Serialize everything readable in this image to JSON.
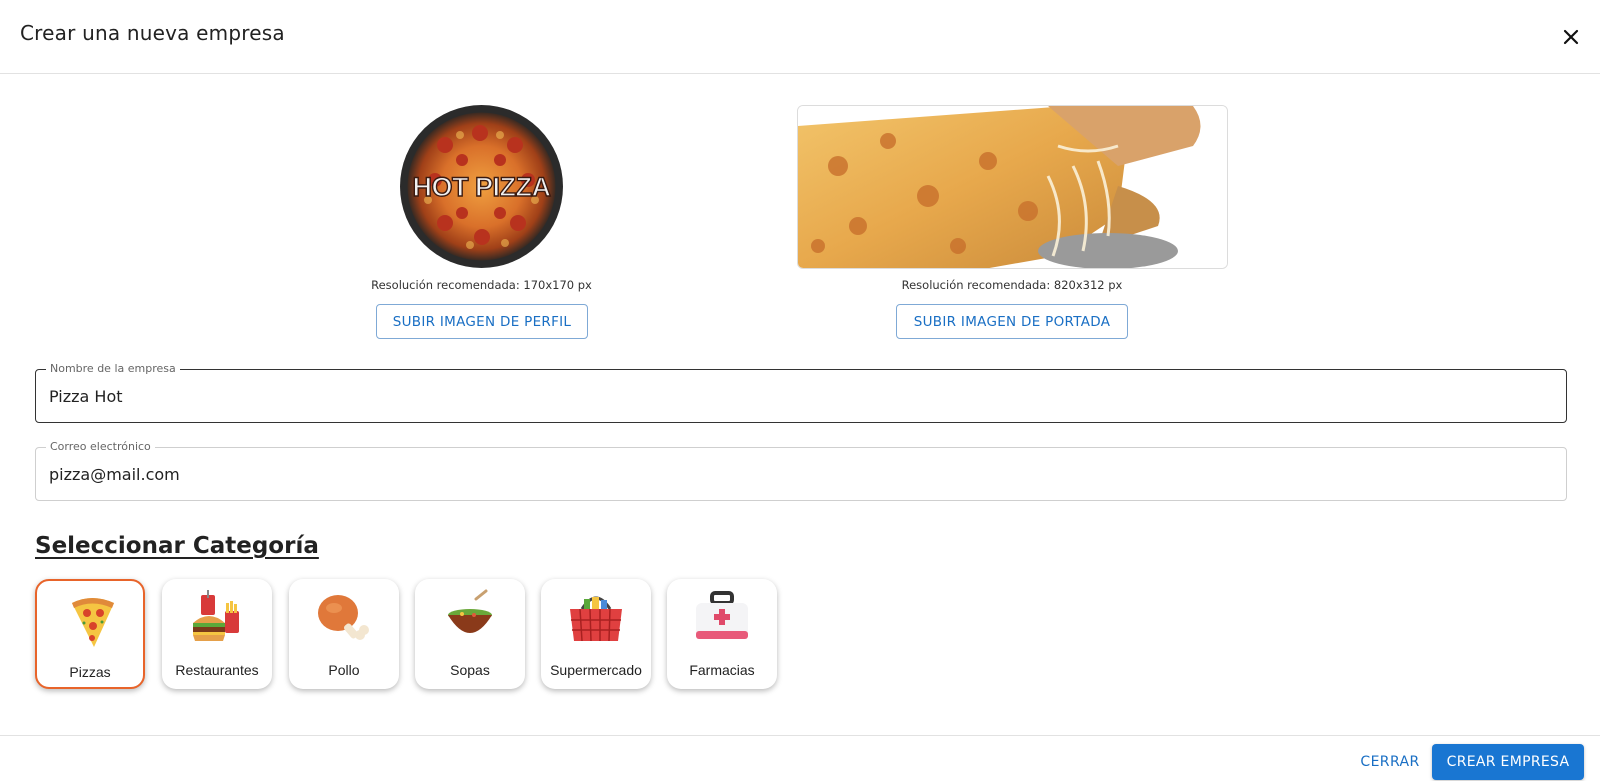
{
  "dialog": {
    "title": "Crear una nueva empresa",
    "close_icon": "close-icon"
  },
  "media": {
    "profile": {
      "image_text": "HOT PIZZA",
      "resolution_text": "Resolución recomendada: 170x170 px",
      "upload_label": "SUBIR IMAGEN DE PERFIL"
    },
    "cover": {
      "resolution_text": "Resolución recomendada: 820x312 px",
      "upload_label": "SUBIR IMAGEN DE PORTADA"
    }
  },
  "form": {
    "company_name": {
      "label": "Nombre de la empresa",
      "value": "Pizza Hot"
    },
    "email": {
      "label": "Correo electrónico",
      "value": "pizza@mail.com"
    }
  },
  "categories": {
    "title": "Seleccionar Categoría",
    "items": [
      {
        "label": "Pizzas",
        "icon": "pizza-slice-icon",
        "selected": true
      },
      {
        "label": "Restaurantes",
        "icon": "burger-meal-icon",
        "selected": false
      },
      {
        "label": "Pollo",
        "icon": "chicken-leg-icon",
        "selected": false
      },
      {
        "label": "Sopas",
        "icon": "soup-bowl-icon",
        "selected": false
      },
      {
        "label": "Supermercado",
        "icon": "shopping-basket-icon",
        "selected": false
      },
      {
        "label": "Farmacias",
        "icon": "first-aid-kit-icon",
        "selected": false
      }
    ],
    "selected_color": "#e8642a"
  },
  "footer": {
    "close_label": "CERRAR",
    "create_label": "CREAR EMPRESA"
  },
  "colors": {
    "accent": "#1976d2",
    "link": "#1a6fc4",
    "selected_border": "#e8642a"
  }
}
